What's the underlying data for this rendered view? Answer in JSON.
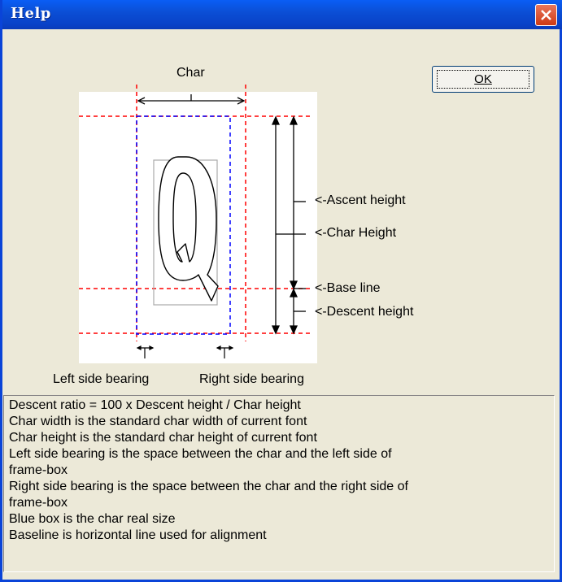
{
  "window": {
    "title": "Help"
  },
  "dialog": {
    "ok_label": "OK",
    "labels": {
      "char": "Char",
      "ascent_height": "<-Ascent height",
      "char_height": "<-Char Height",
      "base_line": "<-Base line",
      "descent_height": "<-Descent height",
      "left_side_bearing": "Left side bearing",
      "right_side_bearing": "Right side bearing",
      "glyph": "Q"
    },
    "description_lines": [
      "Descent ratio = 100 x Descent height / Char height",
      "Char width is the standard char width of current font",
      "Char height is the standard char height of current font",
      "Left side bearing is the space between the char and the left side of",
      "frame-box",
      "Right side bearing is the space between the char and the right side of",
      "frame-box",
      "Blue box is the char real size",
      "Baseline is horizontal line used for alignment"
    ]
  },
  "colors": {
    "guide_red": "#ff0000",
    "char_box_blue": "#0000ff",
    "title_bar": "#0a54e3",
    "close_button": "#d9502c"
  },
  "icons": {
    "close": "close-icon"
  }
}
